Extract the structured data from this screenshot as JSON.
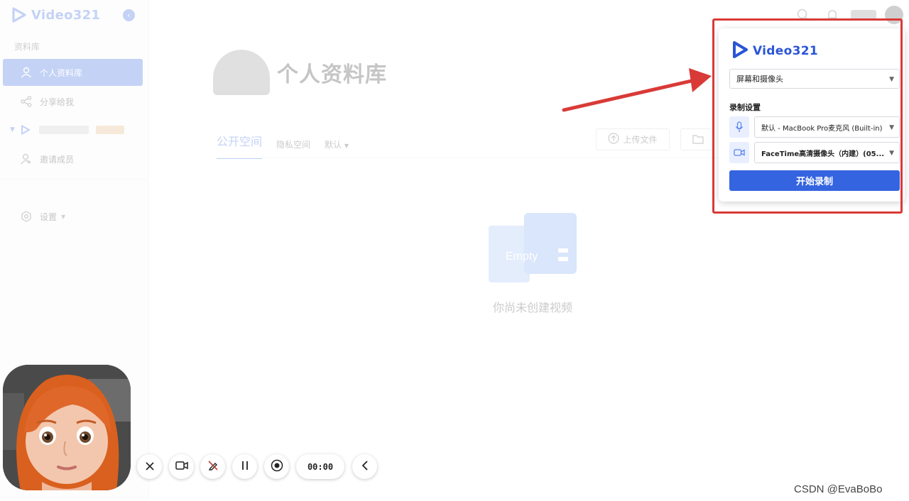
{
  "app": {
    "brand": "Video321",
    "sidebar": {
      "section_label": "资料库",
      "items": [
        {
          "label": "个人资料库",
          "icon": "user-icon",
          "active": true
        },
        {
          "label": "分享给我",
          "icon": "share-icon",
          "active": false
        },
        {
          "label": "",
          "icon": "logo-icon",
          "active": false
        },
        {
          "label": "邀请成员",
          "icon": "user-add-icon",
          "active": false
        }
      ],
      "settings_label": "设置"
    },
    "main": {
      "title": "个人资料库",
      "tabs": [
        "公开空间",
        "隐私空间",
        "默认"
      ],
      "upload_label": "上传文件",
      "empty_illustration_text": "Empty",
      "empty_text": "你尚未创建视频"
    }
  },
  "recorder": {
    "brand": "Video321",
    "mode": "屏幕和摄像头",
    "settings_title": "录制设置",
    "microphone": "默认 - MacBook Pro麦克风 (Built-in)",
    "camera": "FaceTime高清摄像头（内建）(05...",
    "start_label": "开始录制"
  },
  "controls": {
    "timer": "00:00"
  },
  "watermark": "CSDN @EvaBoBo",
  "colors": {
    "accent": "#3464e0",
    "highlight": "#d93a37",
    "icon_bg": "#e9efff"
  }
}
